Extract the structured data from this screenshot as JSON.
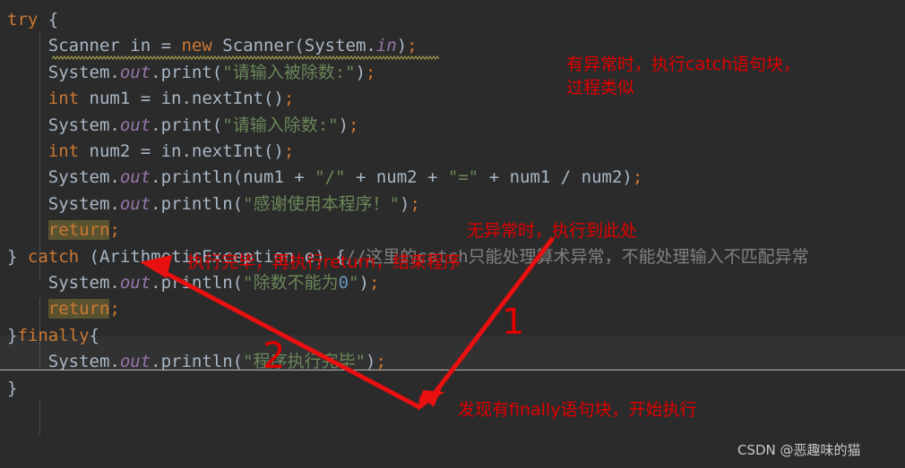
{
  "editor": {
    "background_color": "#2b2b2b",
    "line_highlight_color": "#323232",
    "match_highlight_color": "#5a5330",
    "indent_guide_color": "#4b4f52",
    "divider_color": "#b8b8b8",
    "default_text_color": "#a9b7c6",
    "keyword_color": "#cc7832",
    "string_color": "#6a8759",
    "field_color": "#9876aa",
    "number_color": "#6897bb",
    "comment_color": "#808080",
    "annotation_color": "#e00000",
    "language": "Java"
  },
  "code": {
    "lines": [
      {
        "id": "line-try",
        "tokens": [
          {
            "t": "try",
            "c": "kw"
          },
          {
            "t": " ",
            "c": "punc"
          },
          {
            "t": "{",
            "c": "punc"
          }
        ]
      },
      {
        "id": "line-scanner",
        "tokens": [
          {
            "t": "    ",
            "c": "punc"
          },
          {
            "t": "Scanner",
            "c": "cls"
          },
          {
            "t": " in = ",
            "c": "ident"
          },
          {
            "t": "new",
            "c": "kw"
          },
          {
            "t": " Scanner(System.",
            "c": "ident"
          },
          {
            "t": "in",
            "c": "field"
          },
          {
            "t": ")",
            "c": "paren"
          },
          {
            "t": ";",
            "c": "semi"
          }
        ]
      },
      {
        "id": "line-print-dividend",
        "tokens": [
          {
            "t": "    System.",
            "c": "ident"
          },
          {
            "t": "out",
            "c": "field"
          },
          {
            "t": ".print(",
            "c": "ident"
          },
          {
            "t": "\"请输入被除数:\"",
            "c": "str"
          },
          {
            "t": ")",
            "c": "paren"
          },
          {
            "t": ";",
            "c": "semi"
          }
        ]
      },
      {
        "id": "line-num1",
        "tokens": [
          {
            "t": "    ",
            "c": "punc"
          },
          {
            "t": "int",
            "c": "kw"
          },
          {
            "t": " num1 = in.nextInt()",
            "c": "ident"
          },
          {
            "t": ";",
            "c": "semi"
          }
        ]
      },
      {
        "id": "line-print-divisor",
        "tokens": [
          {
            "t": "    System.",
            "c": "ident"
          },
          {
            "t": "out",
            "c": "field"
          },
          {
            "t": ".print(",
            "c": "ident"
          },
          {
            "t": "\"请输入除数:\"",
            "c": "str"
          },
          {
            "t": ")",
            "c": "paren"
          },
          {
            "t": ";",
            "c": "semi"
          }
        ]
      },
      {
        "id": "line-num2",
        "tokens": [
          {
            "t": "    ",
            "c": "punc"
          },
          {
            "t": "int",
            "c": "kw"
          },
          {
            "t": " num2 = in.nextInt()",
            "c": "ident"
          },
          {
            "t": ";",
            "c": "semi"
          }
        ]
      },
      {
        "id": "line-println-result",
        "tokens": [
          {
            "t": "    System.",
            "c": "ident"
          },
          {
            "t": "out",
            "c": "field"
          },
          {
            "t": ".println(num1 + ",
            "c": "ident"
          },
          {
            "t": "\"/\"",
            "c": "str"
          },
          {
            "t": " + num2 + ",
            "c": "ident"
          },
          {
            "t": "\"=\"",
            "c": "str"
          },
          {
            "t": " + num1 / num2)",
            "c": "ident"
          },
          {
            "t": ";",
            "c": "semi"
          }
        ]
      },
      {
        "id": "line-println-thanks",
        "tokens": [
          {
            "t": "    System.",
            "c": "ident"
          },
          {
            "t": "out",
            "c": "field"
          },
          {
            "t": ".println(",
            "c": "ident"
          },
          {
            "t": "\"感谢使用本程序！\"",
            "c": "str"
          },
          {
            "t": ")",
            "c": "paren"
          },
          {
            "t": ";",
            "c": "semi"
          }
        ]
      },
      {
        "id": "line-return-try",
        "tokens": [
          {
            "t": "    ",
            "c": "punc"
          },
          {
            "t": "return",
            "c": "kw hl-match"
          },
          {
            "t": ";",
            "c": "semi"
          }
        ]
      },
      {
        "id": "line-catch",
        "tokens": [
          {
            "t": "} ",
            "c": "punc"
          },
          {
            "t": "catch",
            "c": "kw"
          },
          {
            "t": " (ArithmeticException e) {",
            "c": "ident"
          },
          {
            "t": "//这里的catch只能处理算术异常，不能处理输入不匹配异常",
            "c": "cmt"
          }
        ]
      },
      {
        "id": "line-println-divzero",
        "tokens": [
          {
            "t": "    System.",
            "c": "ident"
          },
          {
            "t": "out",
            "c": "field"
          },
          {
            "t": ".println(",
            "c": "ident"
          },
          {
            "t": "\"除数不能为",
            "c": "str"
          },
          {
            "t": "0",
            "c": "num"
          },
          {
            "t": "\"",
            "c": "str"
          },
          {
            "t": ")",
            "c": "paren"
          },
          {
            "t": ";",
            "c": "semi"
          }
        ]
      },
      {
        "id": "line-return-catch",
        "tokens": [
          {
            "t": "    ",
            "c": "punc"
          },
          {
            "t": "return",
            "c": "kw hl-match"
          },
          {
            "t": ";",
            "c": "semi"
          }
        ]
      },
      {
        "id": "line-finally",
        "tokens": [
          {
            "t": "}",
            "c": "punc"
          },
          {
            "t": "finally",
            "c": "kw"
          },
          {
            "t": "{",
            "c": "punc"
          }
        ]
      },
      {
        "id": "line-println-done",
        "tokens": [
          {
            "t": "    System.",
            "c": "ident"
          },
          {
            "t": "out",
            "c": "field"
          },
          {
            "t": ".println(",
            "c": "ident"
          },
          {
            "t": "\"程序执行完毕\"",
            "c": "str"
          },
          {
            "t": ")",
            "c": "paren"
          },
          {
            "t": ";",
            "c": "semi"
          }
        ]
      },
      {
        "id": "line-close-brace",
        "tokens": [
          {
            "t": "}",
            "c": "punc"
          }
        ]
      }
    ]
  },
  "annotations": {
    "note_catch_block": "有异常时，执行catch语句块，\n过程类似",
    "note_no_exception": "无异常时，执行到此处",
    "note_return_end": "执行完毕，再执行return，结束程序",
    "note_finally_block": "发现有finally语句块，开始执行",
    "step_one": "1",
    "step_two": "2"
  },
  "watermark": {
    "text": "CSDN @恶趣味的猫"
  }
}
